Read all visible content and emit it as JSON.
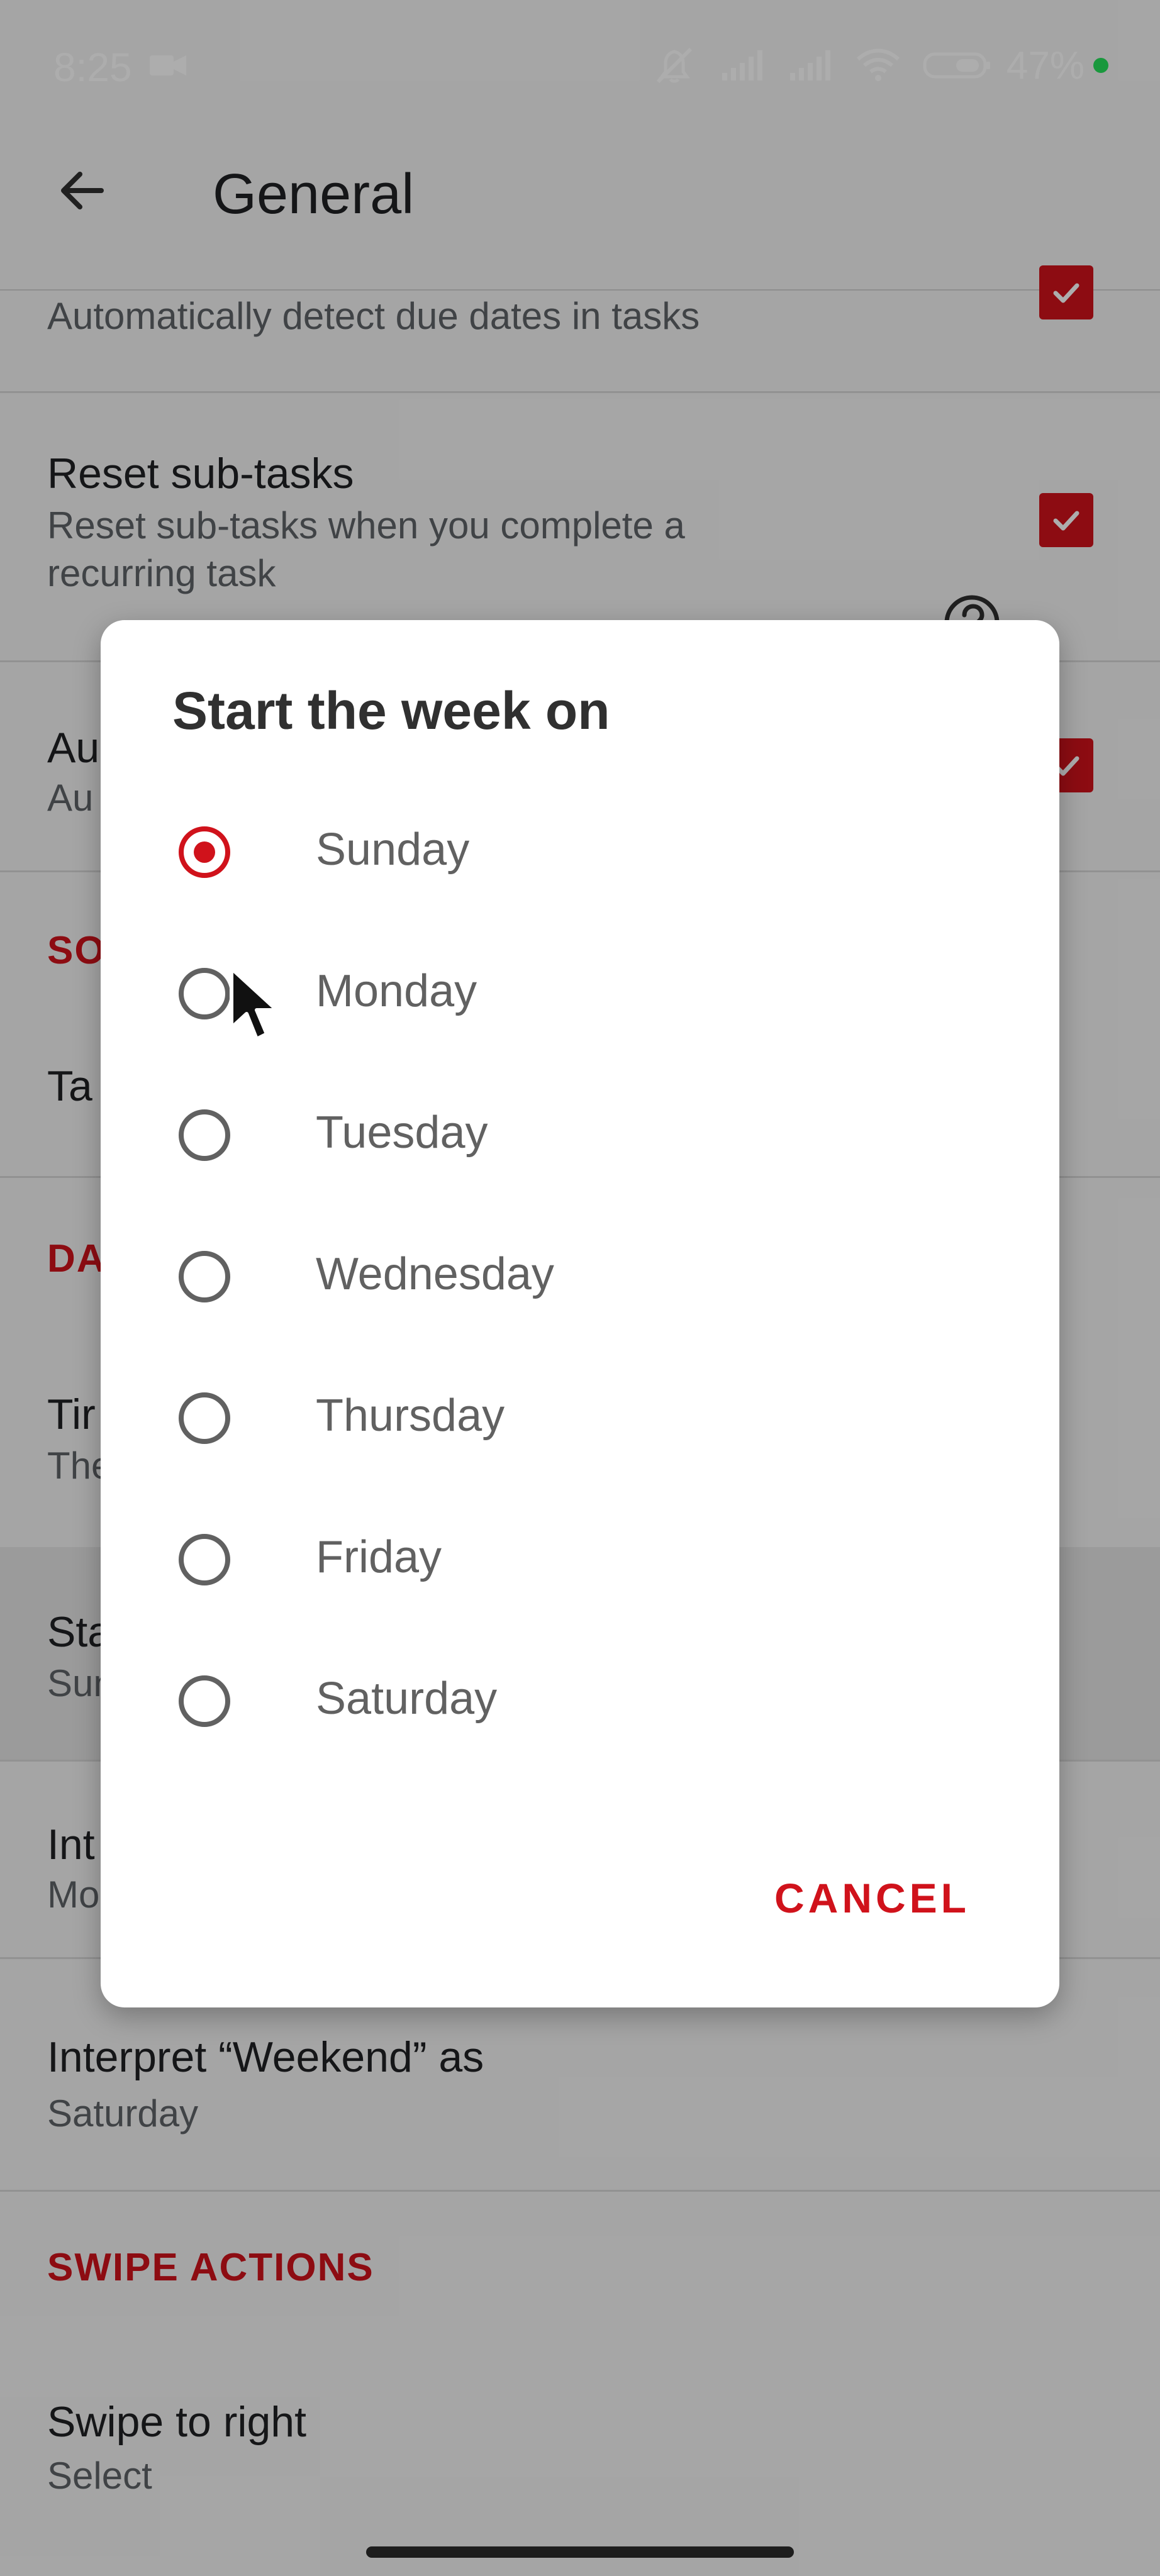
{
  "status_bar": {
    "time": "8:25",
    "battery_percent": "47%"
  },
  "app_bar": {
    "title": "General"
  },
  "settings": {
    "top_summary": "Automatically detect due dates in tasks",
    "reset_subtasks": {
      "title": "Reset sub-tasks",
      "summary": "Reset sub-tasks when you complete a recurring task"
    },
    "partial_row_1": {
      "title": "Au",
      "summary": "Au"
    },
    "partial_section_1": "SO",
    "partial_row_2": {
      "title": "Ta"
    },
    "partial_section_2": "DA",
    "partial_row_3": {
      "title": "Tir",
      "summary": "The"
    },
    "partial_row_4": {
      "title": "Sta",
      "summary": "Sun"
    },
    "partial_row_5": {
      "title": "Int",
      "summary": "Mo"
    },
    "weekend": {
      "title": "Interpret “Weekend” as",
      "summary": "Saturday"
    },
    "swipe_actions_header": "SWIPE ACTIONS",
    "swipe_right": {
      "title": "Swipe to right",
      "summary": "Select"
    }
  },
  "dialog": {
    "title": "Start the week on",
    "options": [
      {
        "label": "Sunday",
        "selected": true
      },
      {
        "label": "Monday",
        "selected": false
      },
      {
        "label": "Tuesday",
        "selected": false
      },
      {
        "label": "Wednesday",
        "selected": false
      },
      {
        "label": "Thursday",
        "selected": false
      },
      {
        "label": "Friday",
        "selected": false
      },
      {
        "label": "Saturday",
        "selected": false
      }
    ],
    "cancel_label": "CANCEL"
  },
  "icons": {
    "back": "back-arrow-icon",
    "video": "video-camera-icon",
    "mute": "muted-alarm-icon",
    "signal": "cellular-signal-icon",
    "wifi": "wifi-icon",
    "battery": "battery-icon",
    "help": "question-icon",
    "checkbox": "checkmark-icon",
    "cursor": "mouse-pointer-icon"
  },
  "colors": {
    "accent": "#d0121b",
    "overlay": "#00000052",
    "dialog_background": "#ffffff",
    "text_secondary": "#5f6368"
  }
}
